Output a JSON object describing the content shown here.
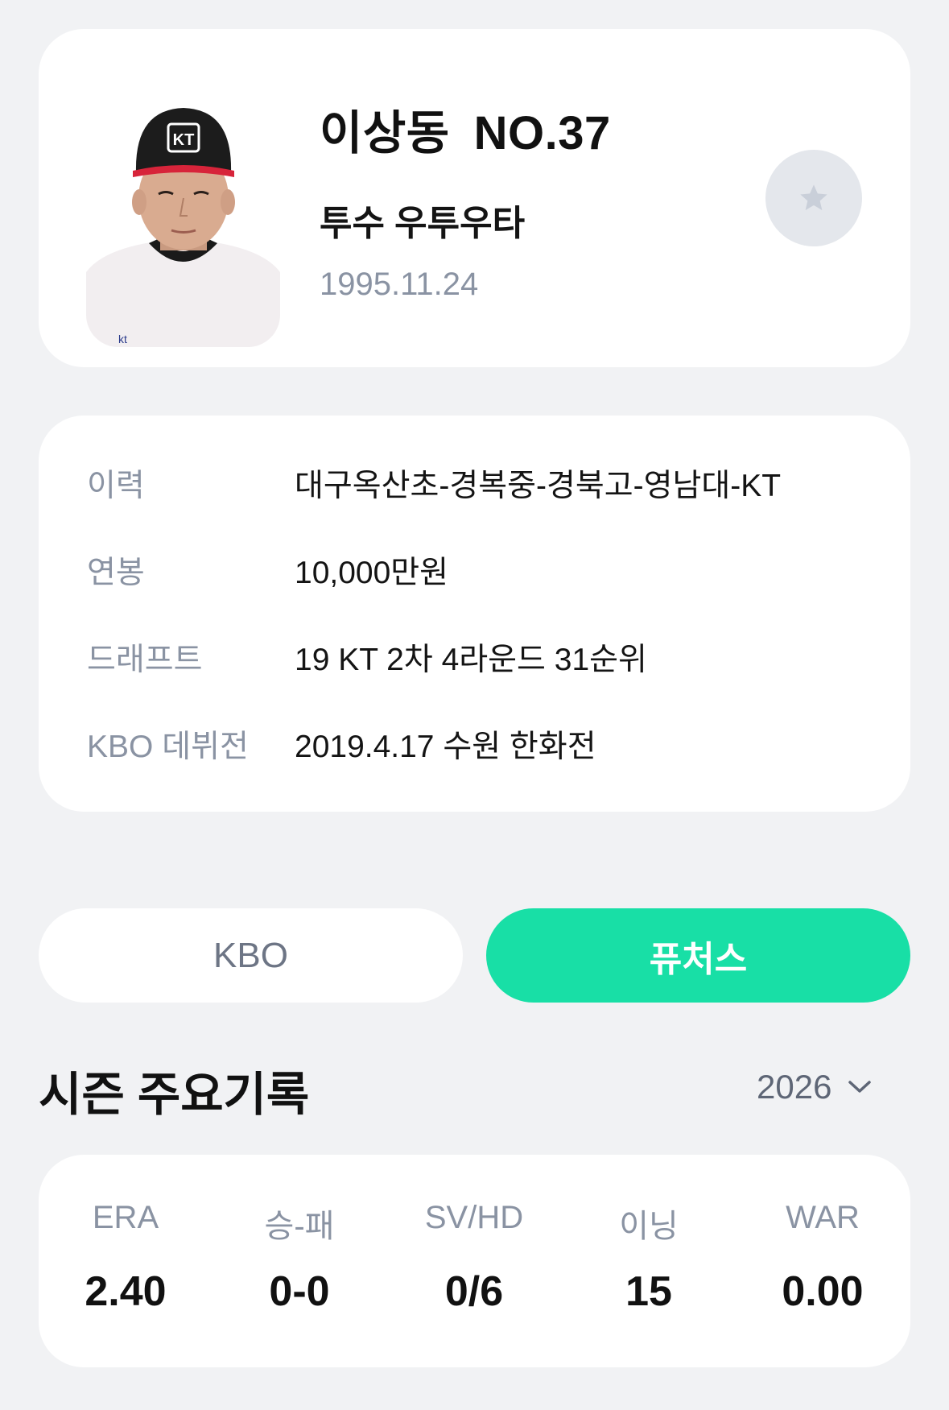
{
  "profile": {
    "name": "이상동",
    "number": "NO.37",
    "position": "투수 우투우타",
    "birth_date": "1995.11.24",
    "favorite_icon": "star-icon",
    "cap_logo": "KT"
  },
  "info": {
    "rows": [
      {
        "label": "이력",
        "value": "대구옥산초-경복중-경북고-영남대-KT"
      },
      {
        "label": "연봉",
        "value": "10,000만원"
      },
      {
        "label": "드래프트",
        "value": "19 KT 2차 4라운드 31순위"
      },
      {
        "label": "KBO 데뷔전",
        "value": "2019.4.17 수원 한화전"
      }
    ]
  },
  "tabs": [
    {
      "label": "KBO",
      "active": false
    },
    {
      "label": "퓨처스",
      "active": true
    }
  ],
  "season": {
    "title": "시즌 주요기록",
    "year": "2026",
    "dropdown_icon": "chevron-down-icon"
  },
  "stats": [
    {
      "label": "ERA",
      "value": "2.40"
    },
    {
      "label": "승-패",
      "value": "0-0"
    },
    {
      "label": "SV/HD",
      "value": "0/6"
    },
    {
      "label": "이닝",
      "value": "15"
    },
    {
      "label": "WAR",
      "value": "0.00"
    }
  ],
  "colors": {
    "background": "#f1f2f4",
    "accent": "#18dfa6",
    "muted_text": "#8a93a3"
  }
}
